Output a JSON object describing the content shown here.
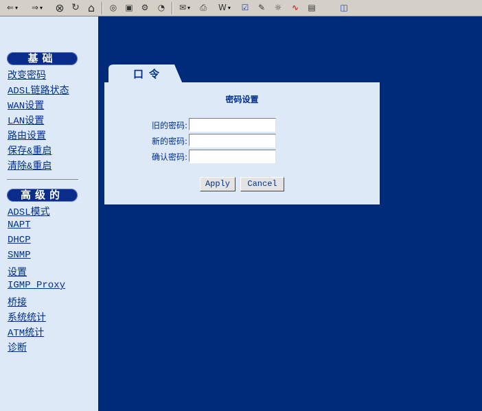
{
  "toolbar": {
    "buttons": [
      {
        "name": "back-icon",
        "glyph": "⇐"
      },
      {
        "name": "forward-icon",
        "glyph": "⇒"
      },
      {
        "name": "stop-icon",
        "glyph": "⊗"
      },
      {
        "name": "refresh-icon",
        "glyph": "↻"
      },
      {
        "name": "home-icon",
        "glyph": "⌂"
      },
      {
        "name": "search-icon",
        "glyph": "🔍"
      },
      {
        "name": "favorites-icon",
        "glyph": "▣"
      },
      {
        "name": "media-icon",
        "glyph": "⚙"
      },
      {
        "name": "history-icon",
        "glyph": "◔"
      },
      {
        "name": "mail-icon",
        "glyph": "✉"
      },
      {
        "name": "print-icon",
        "glyph": "⎙"
      },
      {
        "name": "edit-icon",
        "glyph": "W"
      },
      {
        "name": "messenger-icon",
        "glyph": "☑"
      },
      {
        "name": "tools-icon",
        "glyph": "✎"
      },
      {
        "name": "bulb-icon",
        "glyph": "☼"
      },
      {
        "name": "research-icon",
        "glyph": "∿"
      },
      {
        "name": "disk-icon",
        "glyph": "▤"
      },
      {
        "name": "page-icon",
        "glyph": "◫"
      }
    ]
  },
  "sidebar": {
    "basic_title": "基础",
    "basic_items": [
      "改变密码",
      "ADSL链路状态",
      "WAN设置",
      "LAN设置",
      "路由设置",
      "保存&重启",
      "清除&重启"
    ],
    "advanced_title": "高级的",
    "advanced_items": [
      "ADSL模式",
      "NAPT",
      "DHCP",
      "SNMP",
      "设置",
      "IGMP Proxy",
      "桥接",
      "系统统计",
      "ATM统计",
      "诊断"
    ]
  },
  "panel": {
    "tab_label": "口令",
    "title": "密码设置",
    "old_password_label": "旧的密码:",
    "new_password_label": "新的密码:",
    "confirm_password_label": "确认密码:",
    "old_password_value": "",
    "new_password_value": "",
    "confirm_password_value": "",
    "apply_label": "Apply",
    "cancel_label": "Cancel"
  },
  "colors": {
    "page_bg": "#002a7a",
    "sidebar_bg": "#dde9f7",
    "link": "#002f8c",
    "section_pill": "#0a2d8c"
  }
}
